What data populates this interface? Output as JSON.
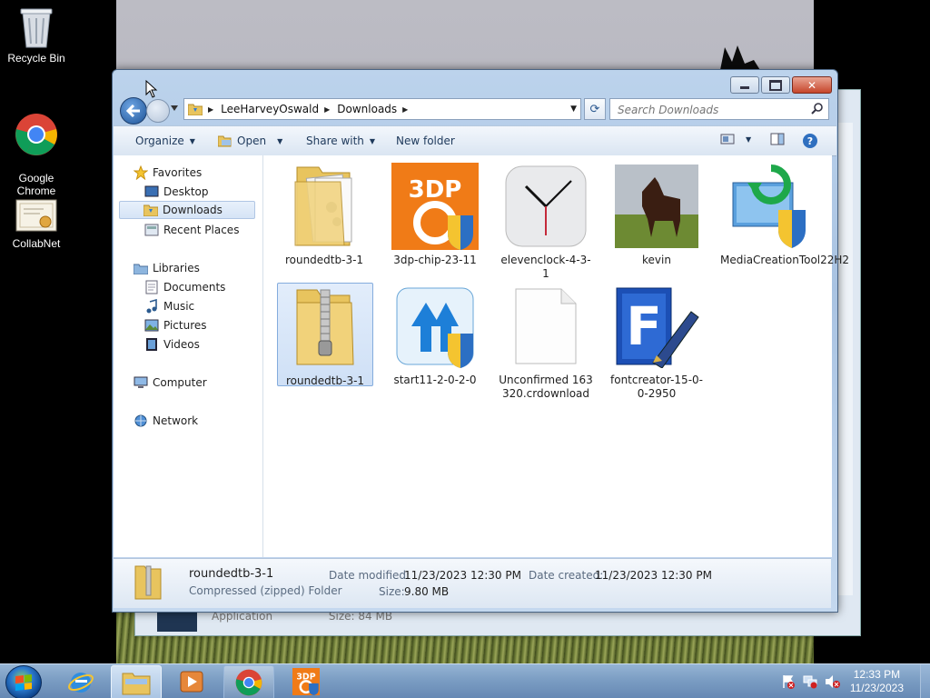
{
  "desktop": {
    "icons": [
      {
        "label": "Recycle Bin"
      },
      {
        "label": "Google\nChrome"
      },
      {
        "label": "CollabNet"
      }
    ]
  },
  "explorer": {
    "breadcrumbs": [
      "LeeHarveyOswald",
      "Downloads"
    ],
    "search_placeholder": "Search Downloads",
    "commands": {
      "organize": "Organize",
      "open": "Open",
      "share_with": "Share with",
      "new_folder": "New folder"
    },
    "nav": {
      "favorites": "Favorites",
      "desktop": "Desktop",
      "downloads": "Downloads",
      "recent_places": "Recent Places",
      "libraries": "Libraries",
      "documents": "Documents",
      "music": "Music",
      "pictures": "Pictures",
      "videos": "Videos",
      "computer": "Computer",
      "network": "Network"
    },
    "files": [
      {
        "name": "roundedtb-3-1",
        "kind": "folder"
      },
      {
        "name": "3dp-chip-23-11",
        "kind": "3dp"
      },
      {
        "name": "elevenclock-4-3-1",
        "kind": "clock"
      },
      {
        "name": "kevin",
        "kind": "photo"
      },
      {
        "name": "MediaCreationTool22H2",
        "kind": "mediatool"
      },
      {
        "name": "roundedtb-3-1",
        "kind": "zip",
        "selected": true
      },
      {
        "name": "start11-2-0-2-0",
        "kind": "start11"
      },
      {
        "name": "Unconfirmed 163320.crdownload",
        "kind": "blank"
      },
      {
        "name": "fontcreator-15-0-0-2950",
        "kind": "fontcreator"
      }
    ],
    "details": {
      "name": "roundedtb-3-1",
      "type": "Compressed (zipped) Folder",
      "date_modified_label": "Date modified:",
      "date_modified": "11/23/2023 12:30 PM",
      "date_created_label": "Date created:",
      "date_created": "11/23/2023 12:30 PM",
      "size_label": "Size:",
      "size": "9.80 MB"
    }
  },
  "back_window": {
    "ghost_text_1": "Application",
    "ghost_text_2": "Size: 84 MB"
  },
  "taskbar": {
    "time": "12:33 PM",
    "date": "11/23/2023"
  },
  "colors": {
    "accent": "#1c5296",
    "selection": "#cfe0f6",
    "taskbar": "#7b9dc3"
  }
}
